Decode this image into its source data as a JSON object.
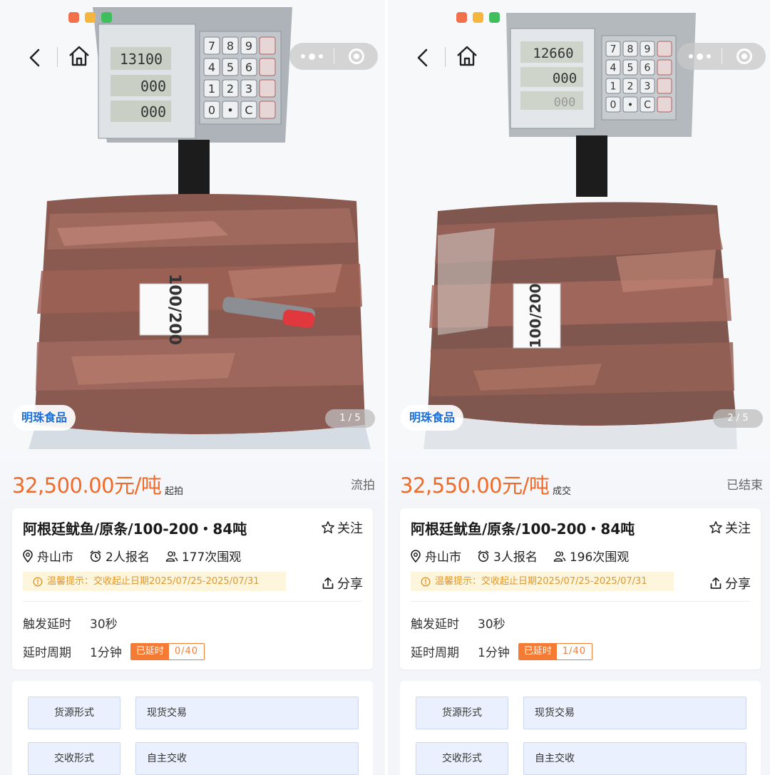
{
  "panels": [
    {
      "brand": "明珠食品",
      "page_counter": "1 / 5",
      "price": "32,500.00元/吨",
      "price_tag": "起拍",
      "status": "流拍",
      "title": "阿根廷鱿鱼/原条/100-200・84吨",
      "follow_label": "关注",
      "location": "舟山市",
      "signups": "2人报名",
      "views": "177次围观",
      "notice": "温馨提示：交收起止日期2025/07/25-2025/07/31",
      "share_label": "分享",
      "trigger_label": "触发延时",
      "trigger_value": "30秒",
      "period_label": "延时周期",
      "period_value": "1分钟",
      "extended_label": "已延时",
      "extended_value": "0/40",
      "attributes": [
        {
          "key": "货源形式",
          "value": "现货交易"
        },
        {
          "key": "交收形式",
          "value": "自主交收"
        }
      ],
      "photo": {
        "scale_display": [
          "13100",
          "000",
          "000"
        ],
        "box_label": "100/200",
        "keypad": [
          "7",
          "8",
          "9",
          "4",
          "5",
          "6",
          "1",
          "2",
          "3",
          "0",
          "•",
          "C"
        ]
      }
    },
    {
      "brand": "明珠食品",
      "page_counter": "2 / 5",
      "price": "32,550.00元/吨",
      "price_tag": "成交",
      "status": "已结束",
      "title": "阿根廷鱿鱼/原条/100-200・84吨",
      "follow_label": "关注",
      "location": "舟山市",
      "signups": "3人报名",
      "views": "196次围观",
      "notice": "温馨提示：交收起止日期2025/07/25-2025/07/31",
      "share_label": "分享",
      "trigger_label": "触发延时",
      "trigger_value": "30秒",
      "period_label": "延时周期",
      "period_value": "1分钟",
      "extended_label": "已延时",
      "extended_value": "1/40",
      "attributes": [
        {
          "key": "货源形式",
          "value": "现货交易"
        },
        {
          "key": "交收形式",
          "value": "自主交收"
        }
      ],
      "photo": {
        "scale_display": [
          "12660",
          "000",
          "000"
        ],
        "box_label": "100/200",
        "keypad": [
          "7",
          "8",
          "9",
          "4",
          "5",
          "6",
          "1",
          "2",
          "3",
          "0",
          "•",
          "C"
        ]
      }
    }
  ],
  "icons": {
    "back": "chevron-left-icon",
    "home": "home-icon",
    "more": "more-dots-icon",
    "close": "close-circle-icon",
    "follow": "star-outline-icon",
    "location": "location-pin-icon",
    "signups": "alarm-clock-icon",
    "views": "people-icon",
    "notice": "info-circle-icon",
    "share": "share-icon"
  },
  "colors": {
    "price": "#f06a2a",
    "brand": "#1a6fd8",
    "notice_bg": "#fdf6dc",
    "notice_text": "#e0962b",
    "badge": "#f57b35",
    "attr_cell": "#eaf0fd"
  }
}
